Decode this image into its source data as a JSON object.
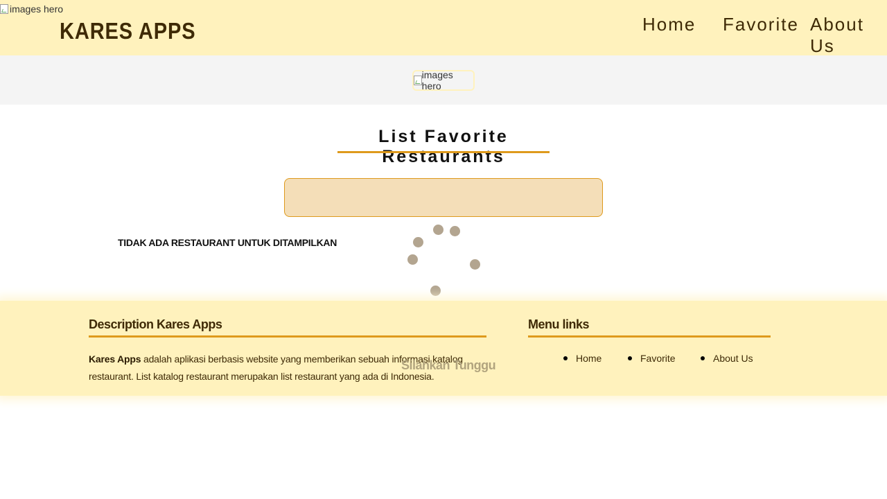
{
  "header": {
    "broken_image_alt": "images hero",
    "brand": "KARES APPS",
    "nav": {
      "home": "Home",
      "favorite": "Favorite",
      "about": "About Us"
    }
  },
  "hero": {
    "image_alt": "images hero"
  },
  "main": {
    "title": "List Favorite Restaurants",
    "empty_message": "TIDAK ADA RESTAURANT UNTUK DITAMPILKAN",
    "loading_text": "Silahkan Tunggu"
  },
  "footer": {
    "description_heading": "Description Kares Apps",
    "description_brand": "Kares Apps",
    "description_body": " adalah aplikasi berbasis website yang memberikan sebuah informasi katalog restaurant. List katalog restaurant merupakan list restaurant yang ada di Indonesia.",
    "menu_heading": "Menu links",
    "menu": {
      "home": "Home",
      "favorite": "Favorite",
      "about": "About Us"
    }
  },
  "colors": {
    "header_bg": "#fff2bd",
    "accent": "#de9a1c",
    "brand_text": "#3e2a06",
    "search_box_bg": "#f4deb8",
    "loader_dot": "#b3a590"
  },
  "icons": {
    "broken_image": "broken-image-icon",
    "loader": "spinner-icon"
  }
}
